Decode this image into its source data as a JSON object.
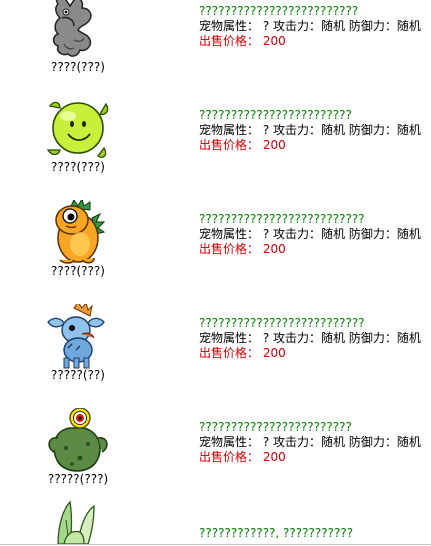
{
  "items": [
    {
      "pet_caption": "????(???)",
      "pet_name": "?????????????????????????",
      "attr_label": "宠物属性：",
      "attr_value": "?",
      "attack_label": "攻击力：",
      "attack_value": "随机",
      "defense_label": "防御力：",
      "defense_value": "随机",
      "price_label": "出售价格：",
      "price_value": "200",
      "icon": "gray-ghost-pet-icon"
    },
    {
      "pet_caption": "????(???)",
      "pet_name": "????????????????????????",
      "attr_label": "宠物属性：",
      "attr_value": "?",
      "attack_label": "攻击力：",
      "attack_value": "随机",
      "defense_label": "防御力：",
      "defense_value": "随机",
      "price_label": "出售价格：",
      "price_value": "200",
      "icon": "green-smiley-pet-icon"
    },
    {
      "pet_caption": "????(???)",
      "pet_name": "??????????????????????????",
      "attr_label": "宠物属性：",
      "attr_value": "?",
      "attack_label": "攻击力：",
      "attack_value": "随机",
      "defense_label": "防御力：",
      "defense_value": "随机",
      "price_label": "出售价格：",
      "price_value": "200",
      "icon": "orange-lizard-pet-icon"
    },
    {
      "pet_caption": "?????(??)",
      "pet_name": "??????????????????????????",
      "attr_label": "宠物属性：",
      "attr_value": "?",
      "attack_label": "攻击力：",
      "attack_value": "随机",
      "defense_label": "防御力：",
      "defense_value": "随机",
      "price_label": "出售价格：",
      "price_value": "200",
      "icon": "blue-horned-pet-icon"
    },
    {
      "pet_caption": "?????(???)",
      "pet_name": "????????????????????????",
      "attr_label": "宠物属性：",
      "attr_value": "?",
      "attack_label": "攻击力：",
      "attack_value": "随机",
      "defense_label": "防御力：",
      "defense_value": "随机",
      "price_label": "出售价格：",
      "price_value": "200",
      "icon": "green-eyeball-pet-icon"
    },
    {
      "pet_name": "????????????, ???????????",
      "icon": "green-leaf-pet-icon"
    }
  ]
}
